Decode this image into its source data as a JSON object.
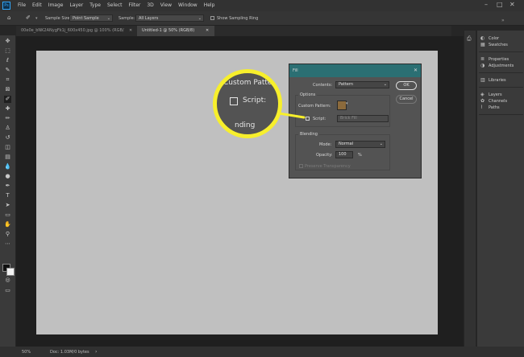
{
  "menubar": {
    "logo_text": "Ps",
    "items": [
      "File",
      "Edit",
      "Image",
      "Layer",
      "Type",
      "Select",
      "Filter",
      "3D",
      "View",
      "Window",
      "Help"
    ],
    "window_controls": [
      "–",
      "□",
      "✕"
    ]
  },
  "options_bar": {
    "sample_size_label": "Sample Size:",
    "sample_size_value": "Point Sample",
    "sample_label": "Sample:",
    "sample_value": "All Layers",
    "show_sampling_ring_label": "Show Sampling Ring"
  },
  "tabs": [
    {
      "label": "00e0e_bNK2ANygFk1j_600x450.jpg @ 100% (RGB/8#)",
      "active": false
    },
    {
      "label": "Untitled-1 @ 50% (RGB/8)",
      "active": true
    }
  ],
  "tab_close_glyph": "✕",
  "tools": [
    "move-icon",
    "marquee-icon",
    "lasso-icon",
    "quick-select-icon",
    "crop-icon",
    "frame-icon",
    "eyedropper-icon",
    "healing-icon",
    "brush-icon",
    "stamp-icon",
    "history-brush-icon",
    "eraser-icon",
    "gradient-icon",
    "blur-icon",
    "dodge-icon",
    "pen-icon",
    "type-icon",
    "path-select-icon",
    "shape-icon",
    "hand-icon",
    "zoom-icon",
    "more-tools-icon"
  ],
  "tool_glyphs": [
    "✥",
    "⬚",
    "ℓ",
    "✎",
    "⌗",
    "⊠",
    "✐",
    "✚",
    "✏",
    "♙",
    "↺",
    "◫",
    "▤",
    "💧",
    "●",
    "✒",
    "T",
    "➤",
    "▭",
    "✋",
    "⚲",
    "⋯"
  ],
  "right_panel": {
    "groups": [
      [
        {
          "label": "Color",
          "icon": "◐"
        },
        {
          "label": "Swatches",
          "icon": "▦"
        }
      ],
      [
        {
          "label": "Properties",
          "icon": "≣"
        },
        {
          "label": "Adjustments",
          "icon": "◑"
        }
      ],
      [
        {
          "label": "Libraries",
          "icon": "▥"
        }
      ],
      [
        {
          "label": "Layers",
          "icon": "◈"
        },
        {
          "label": "Channels",
          "icon": "✿"
        },
        {
          "label": "Paths",
          "icon": "⌇"
        }
      ]
    ]
  },
  "status": {
    "zoom": "50%",
    "doc": "Doc: 1.03M/0 bytes"
  },
  "fill_dialog": {
    "title": "Fill",
    "close_glyph": "✕",
    "contents_label": "Contents:",
    "contents_value": "Pattern",
    "ok_label": "OK",
    "cancel_label": "Cancel",
    "options_label": "Options",
    "custom_pattern_label": "Custom Pattern:",
    "script_label": "Script:",
    "script_value": "Brick Fill",
    "blending_label": "Blending",
    "mode_label": "Mode:",
    "mode_value": "Normal",
    "opacity_label": "Opacity:",
    "opacity_value": "100",
    "opacity_unit": "%",
    "preserve_transparency_label": "Preserve Transparency"
  },
  "magnifier": {
    "line1": "Custom Pattern",
    "line2": "Script:",
    "line3": "nding"
  },
  "colors": {
    "highlight": "#f7ef2c",
    "dialog_title_bar": "#2b6f73",
    "canvas": "#c0c0c0"
  }
}
